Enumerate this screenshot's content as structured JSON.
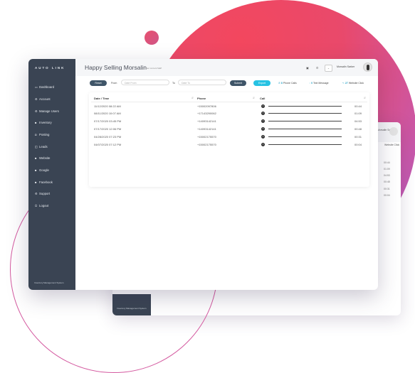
{
  "app": {
    "logo_text": "AUTO LINK",
    "title": "Happy Selling Morsalin",
    "subtitle": "Your current MaP",
    "user_name": "Morsalin Sarker",
    "footer": "Inventory Management System"
  },
  "sidebar": {
    "items": [
      {
        "label": "Dashboard",
        "icon": "dashboard-icon",
        "glyph": "▭"
      },
      {
        "label": "Account",
        "icon": "account-icon",
        "glyph": "⚙"
      },
      {
        "label": "Manage Users",
        "icon": "users-icon",
        "glyph": "⚙"
      },
      {
        "label": "Inventory",
        "icon": "inventory-icon",
        "glyph": "■"
      },
      {
        "label": "Posting",
        "icon": "posting-icon",
        "glyph": "◘"
      },
      {
        "label": "Leads",
        "icon": "leads-icon",
        "glyph": "◫"
      },
      {
        "label": "Website",
        "icon": "website-icon",
        "glyph": "■"
      },
      {
        "label": "Google",
        "icon": "google-icon",
        "glyph": "■"
      },
      {
        "label": "Facebook",
        "icon": "facebook-icon",
        "glyph": "■"
      },
      {
        "label": "Support",
        "icon": "support-icon",
        "glyph": "⚙"
      },
      {
        "label": "Logout",
        "icon": "logout-icon",
        "glyph": "⏻"
      }
    ]
  },
  "toolbar": {
    "reset_label": "Reset",
    "from_label": "From",
    "from_placeholder": "Date From",
    "to_label": "To",
    "to_placeholder": "Date To",
    "submit_label": "Submit",
    "export_label": "Export",
    "phone_calls": {
      "count": "8",
      "label": "Phone Calls"
    },
    "text_message": {
      "count": "0",
      "label": "Text Message"
    },
    "website_click": {
      "count": "27",
      "label": "Website Click"
    }
  },
  "table": {
    "headers": [
      "Date / Time",
      "Phone",
      "Call"
    ],
    "rows": [
      {
        "date": "11/12/2020 08:22 AM",
        "phone": "+15002097806",
        "duration": "00:44"
      },
      {
        "date": "08/11/2020 10:07 AM",
        "phone": "+17143290062",
        "duration": "01:09"
      },
      {
        "date": "07/17/2020 03:45 PM",
        "phone": "+14093142141",
        "duration": "04:53"
      },
      {
        "date": "07/17/2020 12:06 PM",
        "phone": "+14093142141",
        "duration": "00:48"
      },
      {
        "date": "04/28/2020 07:23 PM",
        "phone": "+15002175570",
        "duration": "00:31"
      },
      {
        "date": "04/07/2020 07:12 PM",
        "phone": "+15002175570",
        "duration": "00:04"
      }
    ]
  },
  "back_window": {
    "user_name": "Morsalin Sarker",
    "column_title": "Website Click",
    "values": [
      "00:44",
      "01:09",
      "04:53",
      "00:48",
      "00:31",
      "00:04"
    ],
    "footer": "Inventory Management System"
  },
  "colors": {
    "sidebar": "#3a4453",
    "accent": "#27c2e3",
    "button_dark": "#3f5568",
    "blob_start": "#f3475e",
    "blob_end": "#ab5fc8"
  }
}
